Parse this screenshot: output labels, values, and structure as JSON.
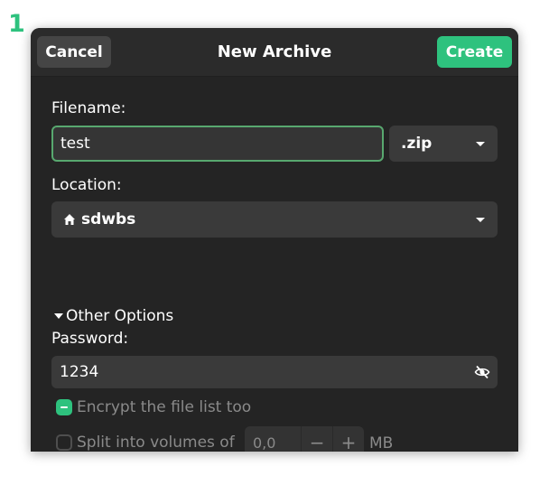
{
  "annotation": {
    "step": "1"
  },
  "header": {
    "title": "New Archive",
    "cancel_label": "Cancel",
    "create_label": "Create"
  },
  "filename": {
    "label": "Filename:",
    "value": "test",
    "extension": ".zip"
  },
  "location": {
    "label": "Location:",
    "value": "sdwbs",
    "icon": "home-icon"
  },
  "other_options": {
    "label": "Other Options",
    "expanded": true
  },
  "password": {
    "label": "Password:",
    "value": "1234",
    "icon": "eye-off-icon"
  },
  "encrypt": {
    "label": "Encrypt the file list too",
    "state": "mixed"
  },
  "split": {
    "label": "Split into volumes of",
    "checked": false,
    "value": "0,0",
    "unit": "MB",
    "minus": "−",
    "plus": "+"
  },
  "colors": {
    "accent": "#2ec27e",
    "dialog_bg": "#242424",
    "header_bg": "#2b2b2b",
    "focus_border": "#58a86f"
  }
}
